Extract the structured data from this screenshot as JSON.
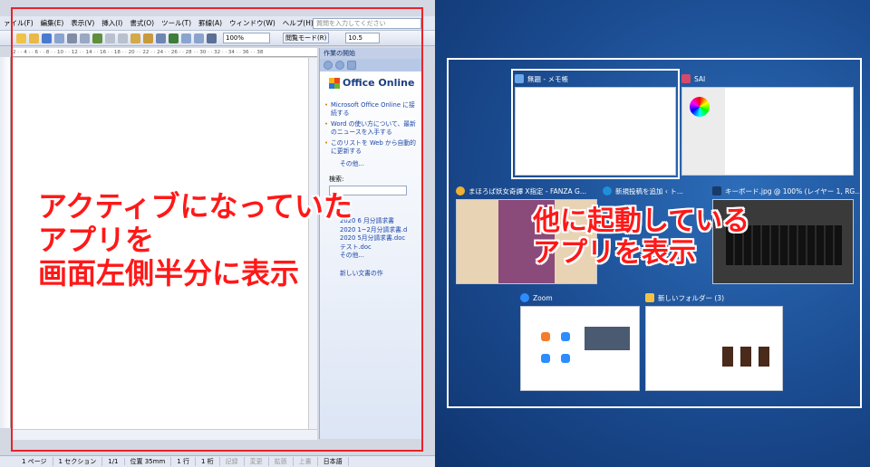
{
  "word": {
    "menus": [
      "ァイル(F)",
      "編集(E)",
      "表示(V)",
      "挿入(I)",
      "書式(O)",
      "ツール(T)",
      "罫線(A)",
      "ウィンドウ(W)",
      "ヘルプ(H)"
    ],
    "help_placeholder": "質問を入力してください",
    "zoom": "100%",
    "read_mode": "閲覧モード(R)",
    "font_size": "10.5",
    "ruler": "2 · · 4 · · 6 · · 8 · · 10 · · 12 · · 14 · · 16 · · 18 · · 20 · · 22 · · 24 · · 26 · · 28 · · 30 · · 32 · · 34 · · 36 · · 38",
    "task_pane": {
      "title": "作業の開始",
      "logo": "Office Online",
      "links": [
        "Microsoft Office Online に接続する",
        "Word の使い方について、最新のニュースを入手する",
        "このリストを Web から自動的に更新する"
      ],
      "more1": "その他...",
      "search_label": "検索:",
      "files": [
        "2020 6 月分請求書",
        "2020 1~2月分請求書.d",
        "2020 5月分請求書.doc",
        "テスト.doc",
        "その他..."
      ],
      "new_doc": "新しい文書の作"
    },
    "status": {
      "page": "1 ページ",
      "section": "1 セクション",
      "pages": "1/1",
      "position": "位置 35mm",
      "line": "1 行",
      "column": "1 桁",
      "rec": "記録",
      "trk": "変更",
      "ext": "拡張",
      "ovr": "上書",
      "lang": "日本語"
    }
  },
  "switcher": {
    "windows": [
      {
        "title": "無題 - メモ帳",
        "icon_color": "#6aa7e8"
      },
      {
        "title": "SAI",
        "icon_color": "#d44a6a"
      },
      {
        "title": "まほろば妖女奇譚 X指定 - FANZA G...",
        "icon_color": "#f0b030"
      },
      {
        "title": "新規投稿を追加 ‹ ト...",
        "icon_color": "#1f8fd9"
      },
      {
        "title": "キーボード.jpg @ 100% (レイヤー 1, RG...",
        "icon_color": "#1a3a6a"
      },
      {
        "title": "Zoom",
        "icon_color": "#2d8cff"
      },
      {
        "title": "新しいフォルダー (3)",
        "icon_color": "#f3c242"
      }
    ]
  },
  "callouts": {
    "left": [
      "アクティブになっていた",
      "アプリを",
      "画面左側半分に表示"
    ],
    "right": [
      "他に起動している",
      "アプリを表示"
    ]
  }
}
